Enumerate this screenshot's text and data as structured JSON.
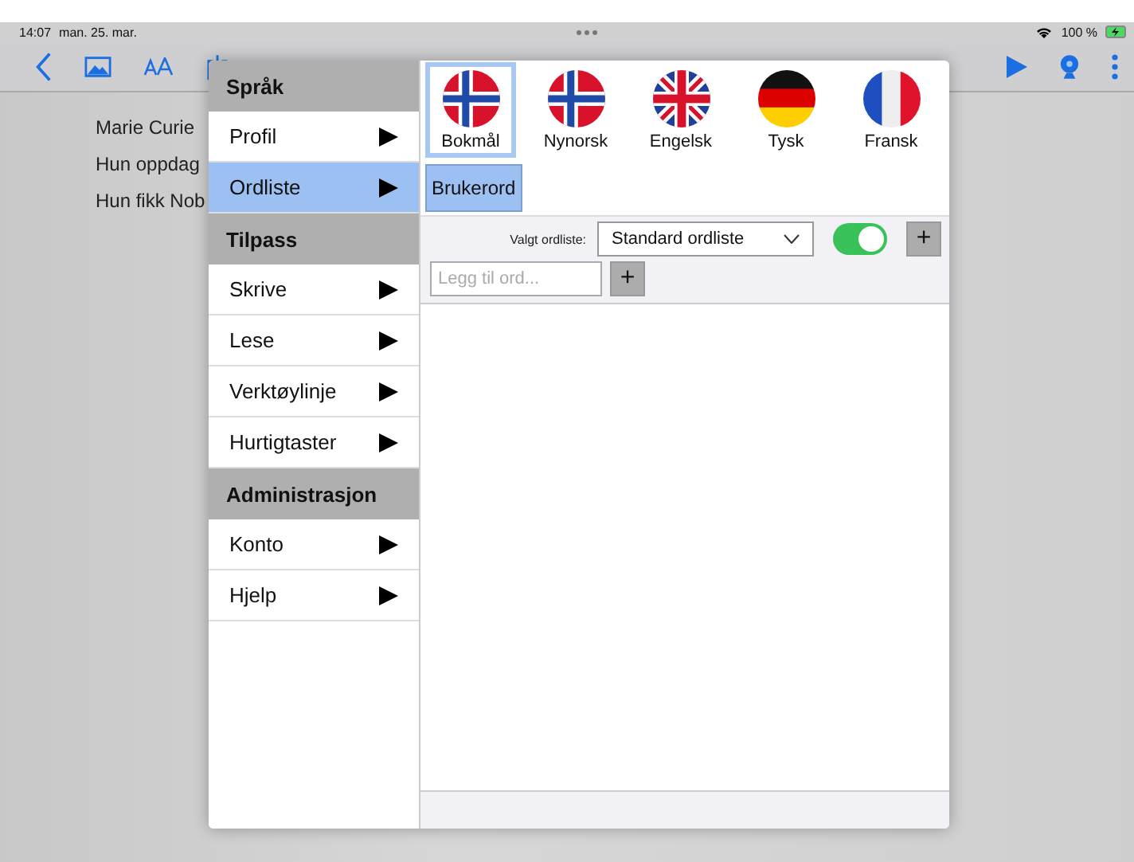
{
  "status_bar": {
    "time": "14:07",
    "date": "man. 25. mar.",
    "battery": "100 %"
  },
  "document": {
    "lines": [
      "Marie Curie",
      "Hun oppdag",
      "Hun fikk Nob"
    ]
  },
  "menu": {
    "sections": [
      {
        "title": "Språk",
        "items": [
          {
            "label": "Profil",
            "selected": false
          },
          {
            "label": "Ordliste",
            "selected": true
          }
        ]
      },
      {
        "title": "Tilpass",
        "items": [
          {
            "label": "Skrive",
            "selected": false
          },
          {
            "label": "Lese",
            "selected": false
          },
          {
            "label": "Verktøylinje",
            "selected": false
          },
          {
            "label": "Hurtigtaster",
            "selected": false
          }
        ]
      },
      {
        "title": "Administrasjon",
        "items": [
          {
            "label": "Konto",
            "selected": false
          },
          {
            "label": "Hjelp",
            "selected": false
          }
        ]
      }
    ]
  },
  "languages": [
    {
      "label": "Bokmål",
      "kind": "norway",
      "selected": true
    },
    {
      "label": "Nynorsk",
      "kind": "norway",
      "selected": false
    },
    {
      "label": "Engelsk",
      "kind": "uk",
      "selected": false
    },
    {
      "label": "Tysk",
      "kind": "germany",
      "selected": false
    },
    {
      "label": "Fransk",
      "kind": "france",
      "selected": false
    }
  ],
  "tabs": [
    {
      "label": "Brukerord",
      "selected": true
    }
  ],
  "wordlist": {
    "label": "Valgt ordliste:",
    "value": "Standard ordliste",
    "on": true,
    "add": "+"
  },
  "add_word": {
    "placeholder": "Legg til ord...",
    "add": "+"
  }
}
